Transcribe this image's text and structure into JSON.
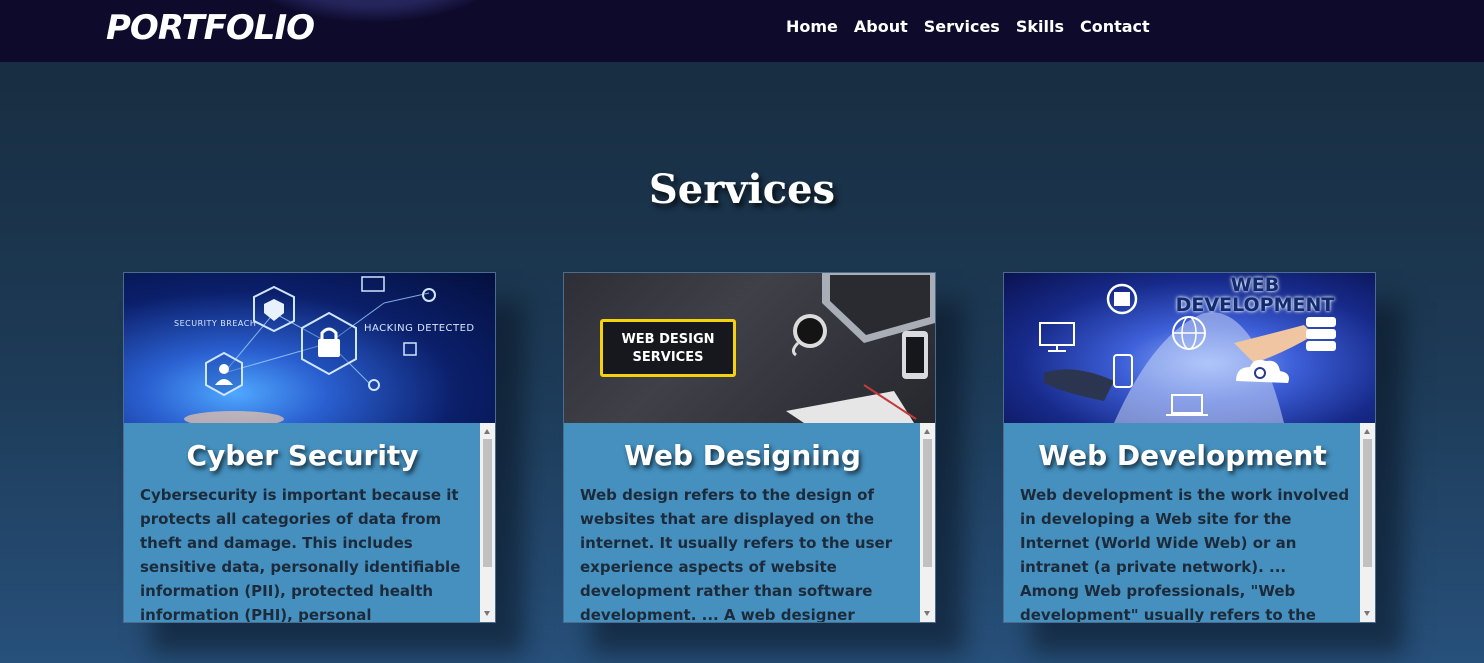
{
  "nav": {
    "brand": "PORTFOLIO",
    "links": [
      "Home",
      "About",
      "Services",
      "Skills",
      "Contact"
    ]
  },
  "section": {
    "title": "Services"
  },
  "cards": [
    {
      "title": "Cyber Security",
      "description": "Cybersecurity is important because it protects all categories of data from theft and damage. This includes sensitive data, personally identifiable information (PII), protected health information (PHI), personal information, intellectual",
      "image_labels": [
        "SECURITY BREACH",
        "HACKING DETECTED"
      ],
      "image_icons": [
        "shield-icon",
        "lock-icon",
        "user-icon",
        "gear-icon"
      ]
    },
    {
      "title": "Web Designing",
      "description": "Web design refers to the design of websites that are displayed on the internet. It usually refers to the user experience aspects of website development rather than software development. ... A web designer works on",
      "image_labels": [
        "WEB DESIGN",
        "SERVICES"
      ],
      "image_icons": [
        "laptop-icon",
        "coffee-cup-icon",
        "phone-icon",
        "notebook-icon"
      ]
    },
    {
      "title": "Web Development",
      "description": "Web development is the work involved in developing a Web site for the Internet (World Wide Web) or an intranet (a private network). ... Among Web professionals, \"Web development\" usually refers to the main non-design aspects of building Web",
      "image_labels": [
        "WEB",
        "DEVELOPMENT"
      ],
      "image_icons": [
        "code-sync-icon",
        "monitor-icon",
        "globe-icon",
        "database-icon",
        "phone-icon",
        "cloud-sync-icon",
        "laptop-icon"
      ]
    }
  ],
  "colors": {
    "navbar_bg": "#0d0a2c",
    "card_body_bg": "#4590bf",
    "text_white": "#ffffff",
    "desc_text": "#1c2a3a"
  }
}
